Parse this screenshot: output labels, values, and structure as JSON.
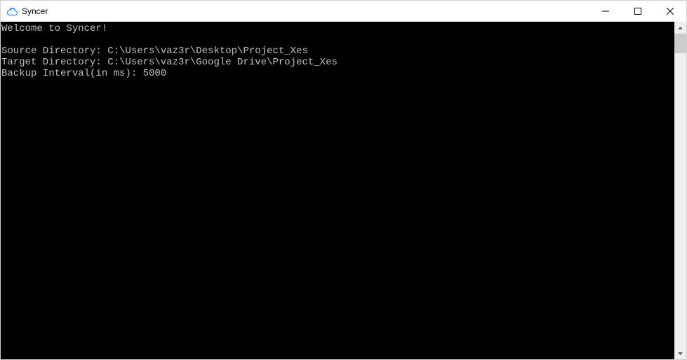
{
  "window": {
    "title": "Syncer"
  },
  "console": {
    "lines": [
      "Welcome to Syncer!",
      "",
      "Source Directory: C:\\Users\\vaz3r\\Desktop\\Project_Xes",
      "Target Directory: C:\\Users\\vaz3r\\Google Drive\\Project_Xes",
      "Backup Interval(in ms): 5000"
    ]
  }
}
